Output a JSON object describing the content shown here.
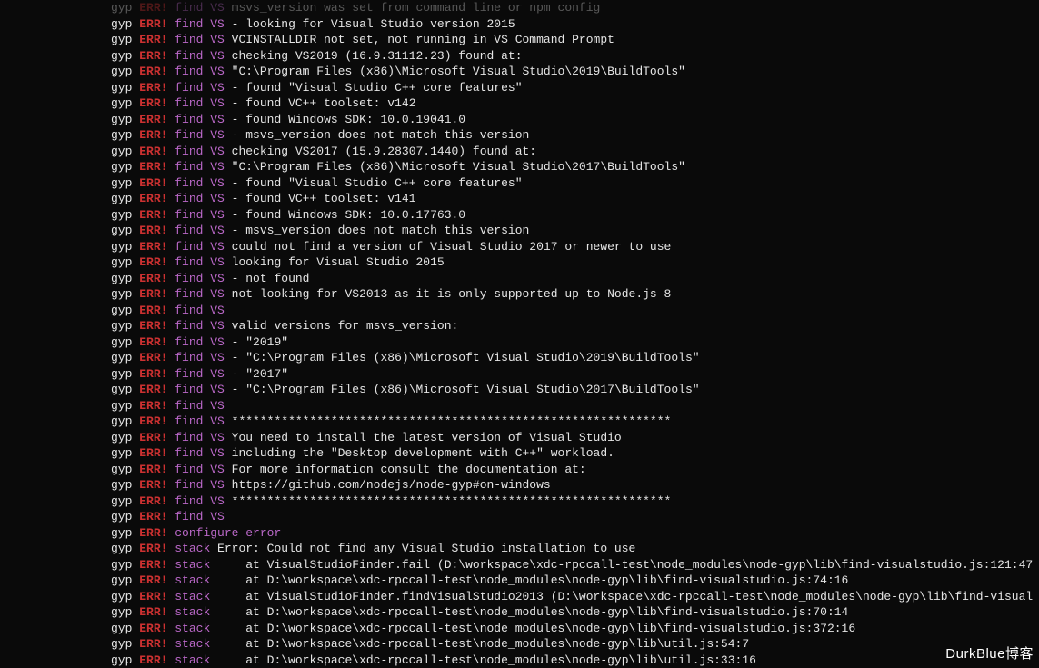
{
  "prefix": "gyp",
  "err": "ERR!",
  "findvs": "find VS",
  "configure": "configure error",
  "stacklabel": "stack",
  "watermark": "DurkBlue博客",
  "lines": [
    {
      "t": "findvs",
      "msg": "msvs_version was set from command line or npm config",
      "faded": true
    },
    {
      "t": "findvs",
      "msg": "- looking for Visual Studio version 2015"
    },
    {
      "t": "findvs",
      "msg": "VCINSTALLDIR not set, not running in VS Command Prompt"
    },
    {
      "t": "findvs",
      "msg": "checking VS2019 (16.9.31112.23) found at:"
    },
    {
      "t": "findvs",
      "msg": "\"C:\\Program Files (x86)\\Microsoft Visual Studio\\2019\\BuildTools\""
    },
    {
      "t": "findvs",
      "msg": "- found \"Visual Studio C++ core features\""
    },
    {
      "t": "findvs",
      "msg": "- found VC++ toolset: v142"
    },
    {
      "t": "findvs",
      "msg": "- found Windows SDK: 10.0.19041.0"
    },
    {
      "t": "findvs",
      "msg": "- msvs_version does not match this version"
    },
    {
      "t": "findvs",
      "msg": "checking VS2017 (15.9.28307.1440) found at:"
    },
    {
      "t": "findvs",
      "msg": "\"C:\\Program Files (x86)\\Microsoft Visual Studio\\2017\\BuildTools\""
    },
    {
      "t": "findvs",
      "msg": "- found \"Visual Studio C++ core features\""
    },
    {
      "t": "findvs",
      "msg": "- found VC++ toolset: v141"
    },
    {
      "t": "findvs",
      "msg": "- found Windows SDK: 10.0.17763.0"
    },
    {
      "t": "findvs",
      "msg": "- msvs_version does not match this version"
    },
    {
      "t": "findvs",
      "msg": "could not find a version of Visual Studio 2017 or newer to use"
    },
    {
      "t": "findvs",
      "msg": "looking for Visual Studio 2015"
    },
    {
      "t": "findvs",
      "msg": "- not found"
    },
    {
      "t": "findvs",
      "msg": "not looking for VS2013 as it is only supported up to Node.js 8"
    },
    {
      "t": "findvs",
      "msg": ""
    },
    {
      "t": "findvs",
      "msg": "valid versions for msvs_version:"
    },
    {
      "t": "findvs",
      "msg": "- \"2019\""
    },
    {
      "t": "findvs",
      "msg": "- \"C:\\Program Files (x86)\\Microsoft Visual Studio\\2019\\BuildTools\""
    },
    {
      "t": "findvs",
      "msg": "- \"2017\""
    },
    {
      "t": "findvs",
      "msg": "- \"C:\\Program Files (x86)\\Microsoft Visual Studio\\2017\\BuildTools\""
    },
    {
      "t": "findvs",
      "msg": ""
    },
    {
      "t": "findvs",
      "msg": "**************************************************************"
    },
    {
      "t": "findvs",
      "msg": "You need to install the latest version of Visual Studio"
    },
    {
      "t": "findvs",
      "msg": "including the \"Desktop development with C++\" workload."
    },
    {
      "t": "findvs",
      "msg": "For more information consult the documentation at:"
    },
    {
      "t": "findvs",
      "msg": "https://github.com/nodejs/node-gyp#on-windows"
    },
    {
      "t": "findvs",
      "msg": "**************************************************************"
    },
    {
      "t": "findvs",
      "msg": ""
    },
    {
      "t": "configure",
      "msg": ""
    },
    {
      "t": "stack",
      "msg": "Error: Could not find any Visual Studio installation to use"
    },
    {
      "t": "stack",
      "msg": "    at VisualStudioFinder.fail (D:\\workspace\\xdc-rpccall-test\\node_modules\\node-gyp\\lib\\find-visualstudio.js:121:47"
    },
    {
      "t": "stack",
      "msg": "    at D:\\workspace\\xdc-rpccall-test\\node_modules\\node-gyp\\lib\\find-visualstudio.js:74:16"
    },
    {
      "t": "stack",
      "msg": "    at VisualStudioFinder.findVisualStudio2013 (D:\\workspace\\xdc-rpccall-test\\node_modules\\node-gyp\\lib\\find-visual"
    },
    {
      "t": "stack",
      "msg": "    at D:\\workspace\\xdc-rpccall-test\\node_modules\\node-gyp\\lib\\find-visualstudio.js:70:14"
    },
    {
      "t": "stack",
      "msg": "    at D:\\workspace\\xdc-rpccall-test\\node_modules\\node-gyp\\lib\\find-visualstudio.js:372:16"
    },
    {
      "t": "stack",
      "msg": "    at D:\\workspace\\xdc-rpccall-test\\node_modules\\node-gyp\\lib\\util.js:54:7"
    },
    {
      "t": "stack",
      "msg": "    at D:\\workspace\\xdc-rpccall-test\\node_modules\\node-gyp\\lib\\util.js:33:16"
    }
  ]
}
